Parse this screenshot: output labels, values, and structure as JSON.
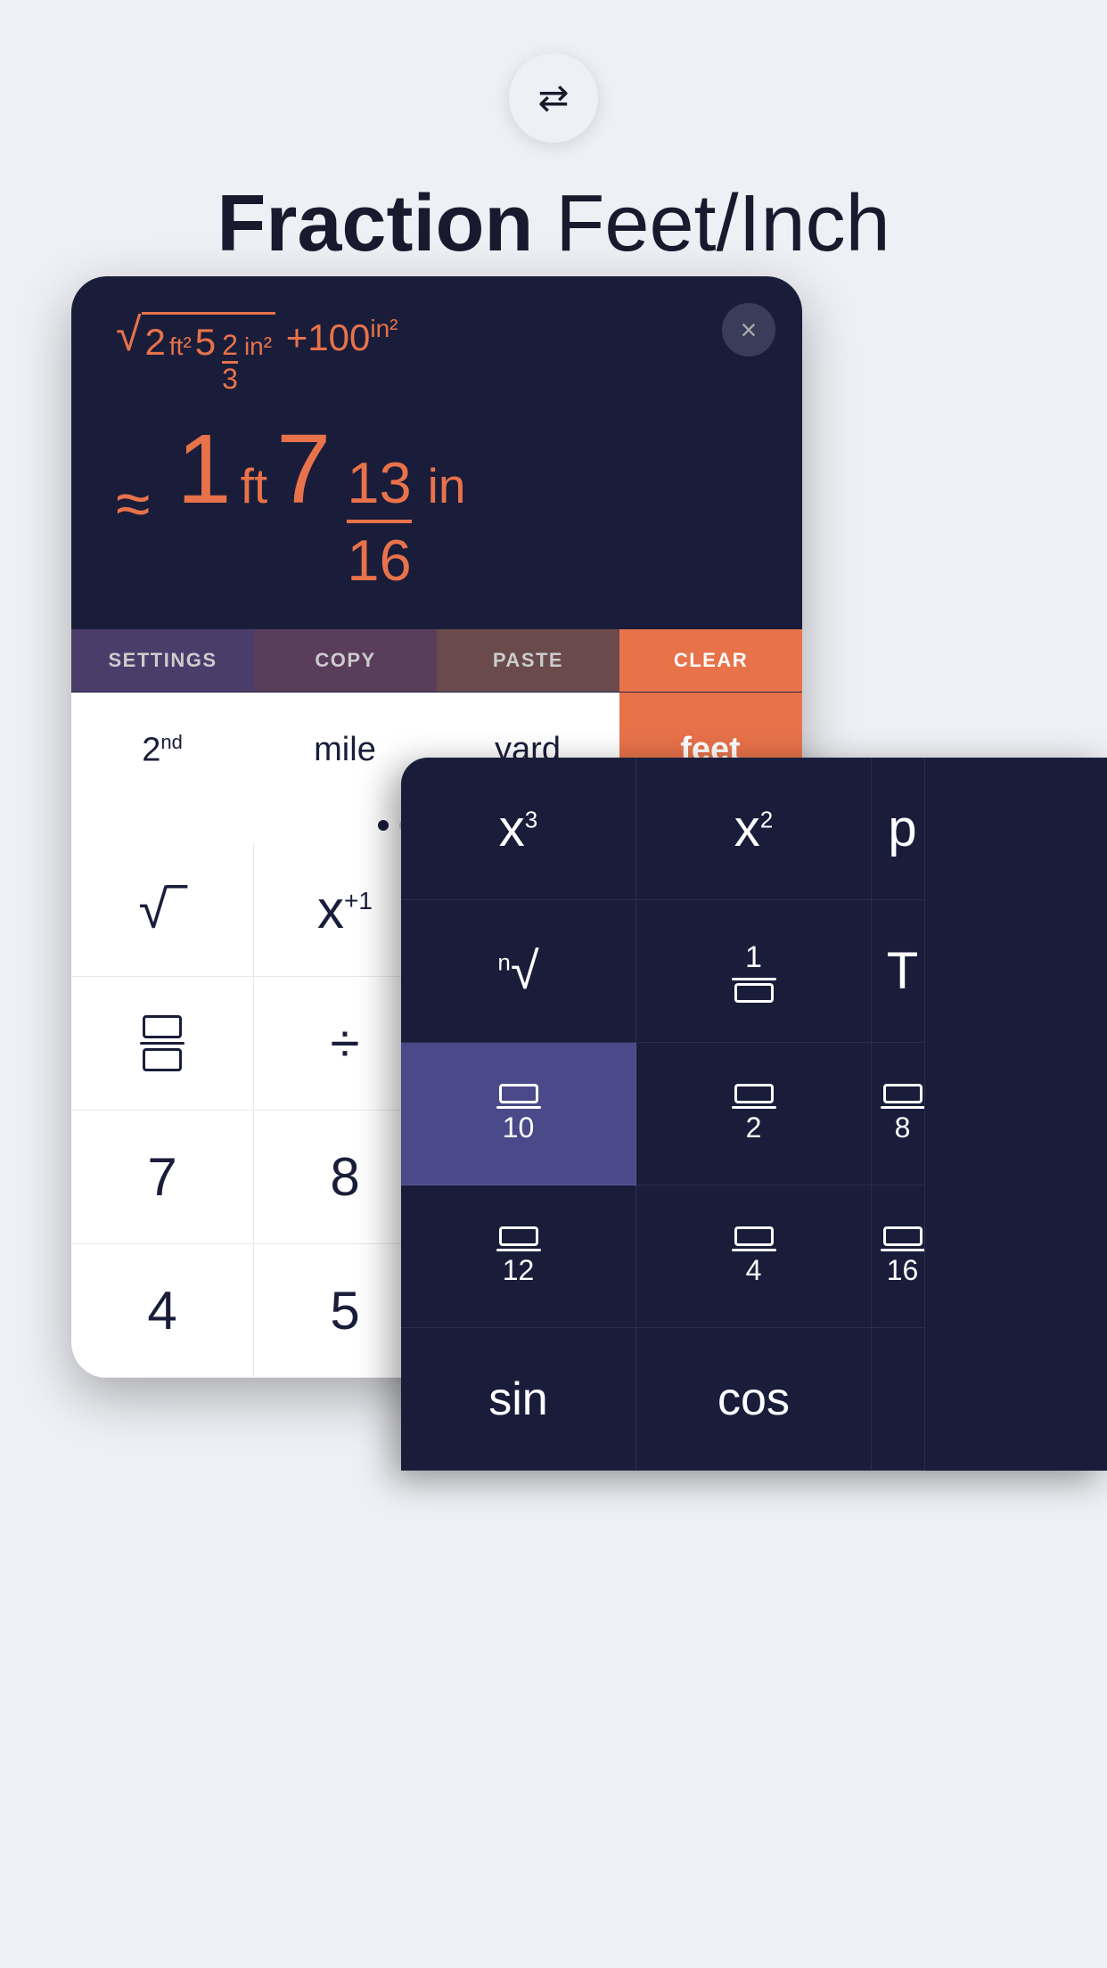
{
  "header": {
    "title_bold": "Fraction",
    "title_light": " Feet/Inch"
  },
  "swap_button": {
    "label": "⇄"
  },
  "display": {
    "expression": "√2ft² 5⅔in² +100in²",
    "approx": "≈",
    "result_whole_ft": "1",
    "result_unit_ft": "ft",
    "result_whole_in": "7",
    "result_frac_num": "13",
    "result_frac_den": "16",
    "result_unit_in": "in",
    "close_label": "×"
  },
  "action_bar": {
    "settings": "SETTINGS",
    "copy": "COPY",
    "paste": "PASTE",
    "clear": "CLEAR"
  },
  "unit_row": {
    "btn1": "2nd",
    "btn1_sup": "",
    "btn2": "mile",
    "btn3": "yard",
    "btn4": "feet"
  },
  "keypad": {
    "row1": [
      "√",
      "x⁺¹",
      "",
      ""
    ],
    "row2": [
      "⊟",
      "÷",
      "",
      ""
    ],
    "row3": [
      "7",
      "8",
      "",
      ""
    ],
    "row4": [
      "4",
      "5",
      "",
      ""
    ]
  },
  "overlay": {
    "row1": [
      "x³",
      "x²",
      "p"
    ],
    "row2": [
      "ⁿ√",
      "1/□",
      "T"
    ],
    "row3_highlight": "□/10",
    "row3": [
      "□/10",
      "□/2",
      "□/8"
    ],
    "row4": [
      "□/12",
      "□/4",
      "□/16"
    ],
    "row5": [
      "sin",
      "cos",
      ""
    ]
  },
  "dots": [
    true,
    false,
    false,
    false,
    false,
    false
  ]
}
